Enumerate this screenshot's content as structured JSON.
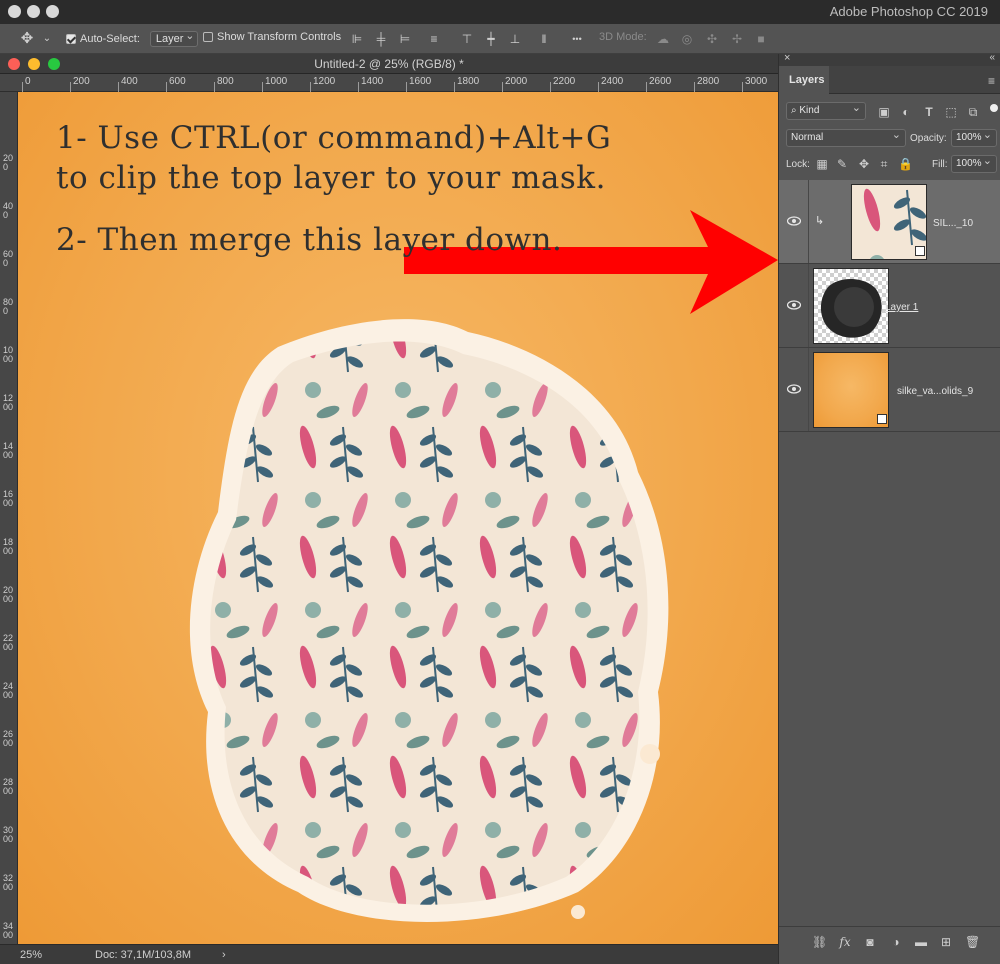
{
  "app": {
    "title": "Adobe Photoshop CC 2019"
  },
  "options": {
    "auto_select_label": "Auto-Select:",
    "auto_select_value": "Layer",
    "show_transform_label": "Show Transform Controls",
    "more_label": "•••",
    "mode_3d_label": "3D Mode:"
  },
  "document": {
    "title": "Untitled-2 @ 25% (RGB/8) *",
    "ruler_h": [
      "0",
      "200",
      "400",
      "600",
      "800",
      "1000",
      "1200",
      "1400",
      "1600",
      "1800",
      "2000",
      "2200",
      "2400",
      "2600",
      "2800",
      "3000"
    ],
    "ruler_v": [
      "200",
      "400",
      "600",
      "800",
      "1000",
      "1200",
      "1400",
      "1600",
      "1800",
      "2000",
      "2200",
      "2400",
      "2600",
      "2800",
      "3000",
      "3200",
      "3400"
    ],
    "text_line1": "1- Use CTRL(or command)+Alt+G",
    "text_line2": "to clip the top layer to your mask.",
    "text_line3": "2- Then merge this layer down.",
    "zoom": "25%",
    "doc_size": "Doc: 37,1M/103,8M",
    "status_arrow": "›"
  },
  "layers_panel": {
    "tab": "Layers",
    "filter_kind": "Kind",
    "blend_mode": "Normal",
    "opacity_label": "Opacity:",
    "opacity_value": "100%",
    "lock_label": "Lock:",
    "fill_label": "Fill:",
    "fill_value": "100%",
    "layers": [
      {
        "name": "SIL..._10",
        "clipped": true,
        "selected": true
      },
      {
        "name": "Layer 1",
        "clipped": false,
        "selected": false
      },
      {
        "name": "silke_va...olids_9",
        "clipped": false,
        "selected": false
      }
    ],
    "footer_fx": "fx"
  },
  "colors": {
    "canvas_orange": "#f2a84c",
    "arrow_red": "#ff0000",
    "text_dark": "#2f2f2f"
  }
}
